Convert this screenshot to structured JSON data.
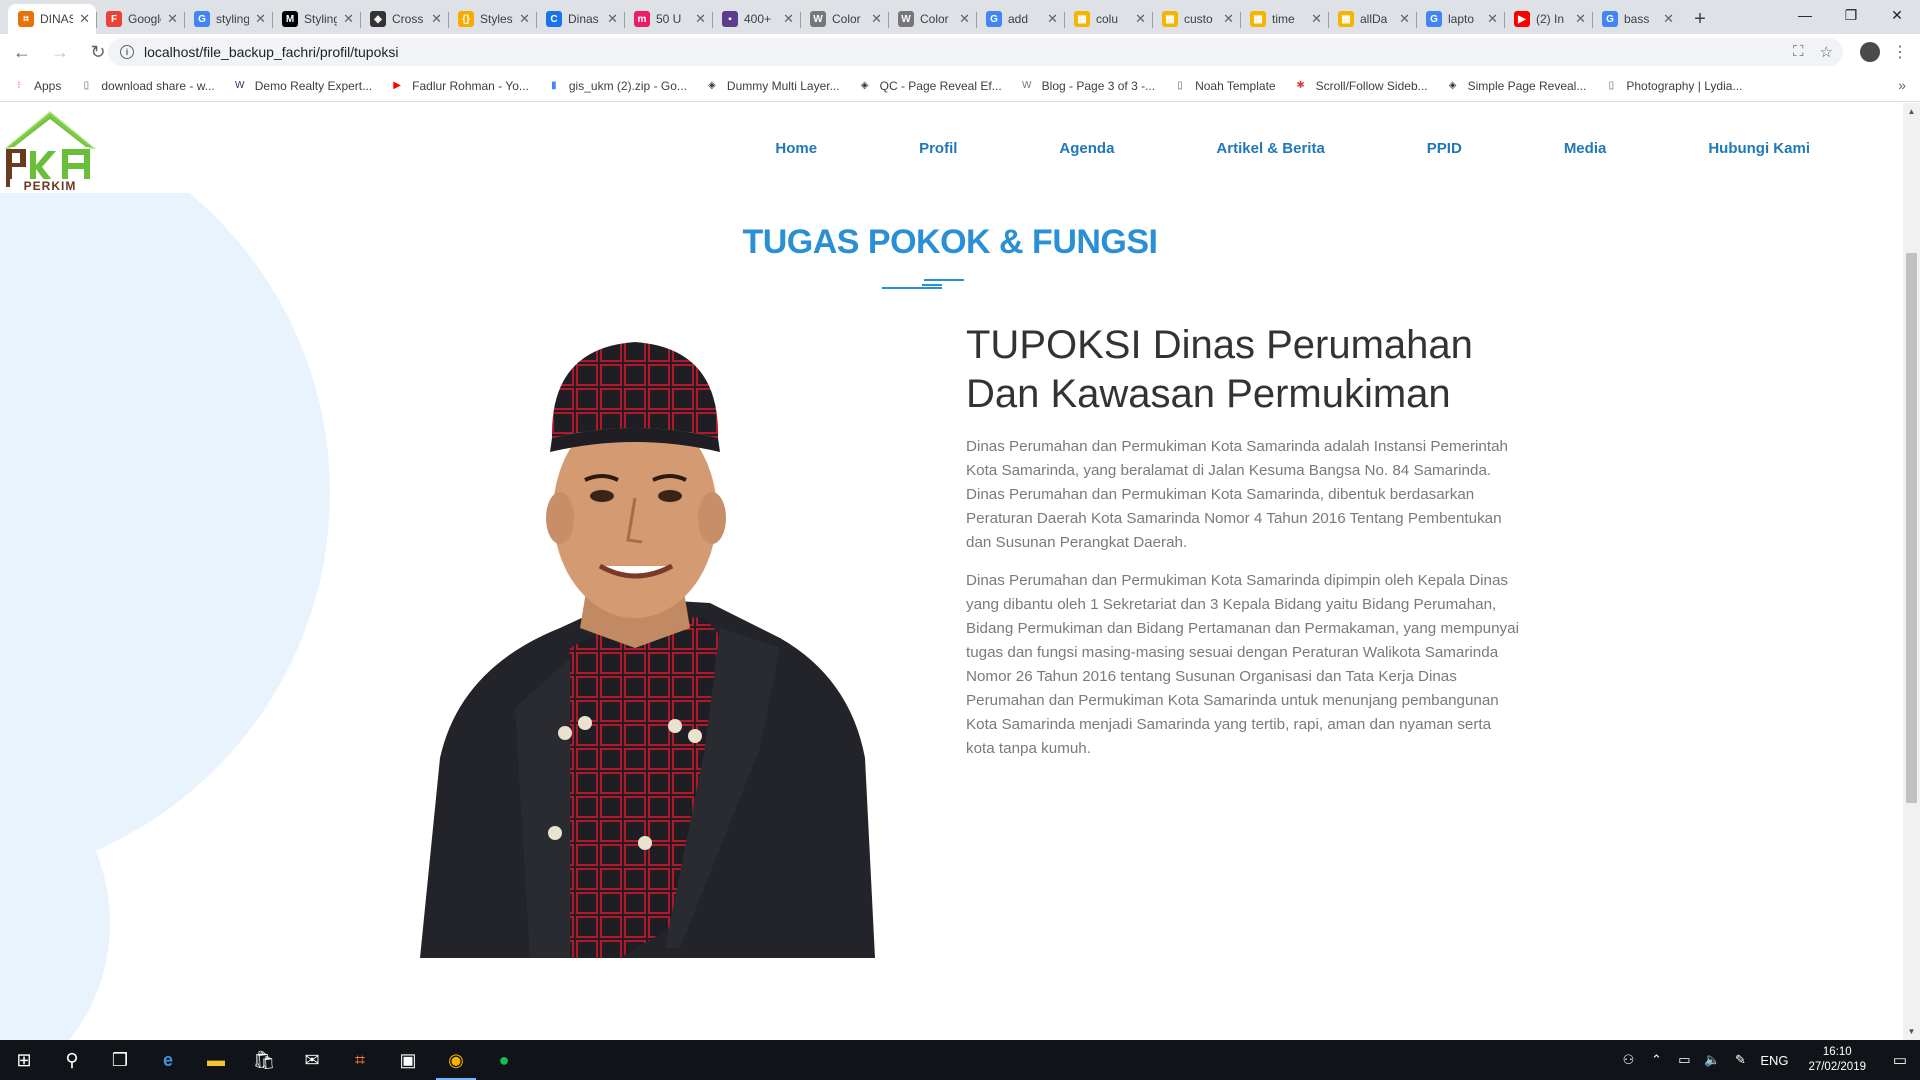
{
  "browser": {
    "tabs": [
      {
        "title": "DINAS",
        "color": "#e8710a",
        "glyph": "⌗",
        "active": true
      },
      {
        "title": "Google",
        "color": "#ea4335",
        "glyph": "F"
      },
      {
        "title": "styling",
        "color": "#4285f4",
        "glyph": "G"
      },
      {
        "title": "Styling",
        "color": "#000000",
        "glyph": "M"
      },
      {
        "title": "Cross",
        "color": "#333333",
        "glyph": "◈"
      },
      {
        "title": "Styles",
        "color": "#f9ab00",
        "glyph": "{}"
      },
      {
        "title": "Dinas",
        "color": "#1a73e8",
        "glyph": "C"
      },
      {
        "title": "50 U",
        "color": "#e91e63",
        "glyph": "m"
      },
      {
        "title": "400+",
        "color": "#5c3c8c",
        "glyph": "▪"
      },
      {
        "title": "Color",
        "color": "#777777",
        "glyph": "W"
      },
      {
        "title": "Color",
        "color": "#777777",
        "glyph": "W"
      },
      {
        "title": "add",
        "color": "#4285f4",
        "glyph": "G"
      },
      {
        "title": "colu",
        "color": "#f4b400",
        "glyph": "▦"
      },
      {
        "title": "custo",
        "color": "#f4b400",
        "glyph": "▦"
      },
      {
        "title": "time",
        "color": "#f4b400",
        "glyph": "▦"
      },
      {
        "title": "allDa",
        "color": "#f4b400",
        "glyph": "▦"
      },
      {
        "title": "lapto",
        "color": "#4285f4",
        "glyph": "G"
      },
      {
        "title": "(2) In",
        "color": "#ff0000",
        "glyph": "▶"
      },
      {
        "title": "bass",
        "color": "#4285f4",
        "glyph": "G"
      }
    ],
    "new_tab": "+",
    "window_controls": {
      "minimize": "—",
      "restore": "❐",
      "close": "✕"
    },
    "url": "localhost/file_backup_fachri/profil/tupoksi",
    "bookmarks": [
      {
        "label": "Apps",
        "color": "#ea4335",
        "glyph": "⁝"
      },
      {
        "label": "download share - w...",
        "color": "#5f6368",
        "glyph": "▯"
      },
      {
        "label": "Demo Realty Expert...",
        "color": "#1e3a5f",
        "glyph": "W"
      },
      {
        "label": "Fadlur Rohman - Yo...",
        "color": "#ff0000",
        "glyph": "▶"
      },
      {
        "label": "gis_ukm (2).zip - Go...",
        "color": "#4285f4",
        "glyph": "▮"
      },
      {
        "label": "Dummy Multi Layer...",
        "color": "#333333",
        "glyph": "◈"
      },
      {
        "label": "QC - Page Reveal Ef...",
        "color": "#333333",
        "glyph": "◈"
      },
      {
        "label": "Blog - Page 3 of 3 -...",
        "color": "#777777",
        "glyph": "W"
      },
      {
        "label": "Noah Template",
        "color": "#5f6368",
        "glyph": "▯"
      },
      {
        "label": "Scroll/Follow Sideb...",
        "color": "#e53935",
        "glyph": "✱"
      },
      {
        "label": "Simple Page Reveal...",
        "color": "#333333",
        "glyph": "◈"
      },
      {
        "label": "Photography | Lydia...",
        "color": "#5f6368",
        "glyph": "▯"
      }
    ],
    "bookmarks_more": "»"
  },
  "site": {
    "logo_text": "PERKIM",
    "nav": [
      "Home",
      "Profil",
      "Agenda",
      "Artikel & Berita",
      "PPID",
      "Media",
      "Hubungi Kami"
    ],
    "section_title": "TUGAS POKOK & FUNGSI",
    "heading": "TUPOKSI Dinas Perumahan Dan Kawasan Permukiman",
    "paragraph_1": "Dinas Perumahan dan Permukiman Kota Samarinda adalah Instansi Pemerintah Kota Samarinda, yang beralamat di Jalan Kesuma Bangsa No. 84 Samarinda. Dinas Perumahan dan Permukiman Kota Samarinda, dibentuk berdasarkan Peraturan Daerah Kota Samarinda Nomor 4 Tahun 2016 Tentang Pembentukan dan Susunan Perangkat Daerah.",
    "paragraph_2": "Dinas Perumahan dan Permukiman Kota Samarinda dipimpin oleh Kepala Dinas yang dibantu oleh 1 Sekretariat dan 3 Kepala Bidang yaitu Bidang Perumahan, Bidang Permukiman dan Bidang Pertamanan dan Permakaman, yang mempunyai tugas dan fungsi masing-masing sesuai dengan Peraturan Walikota Samarinda Nomor 26 Tahun 2016 tentang Susunan Organisasi dan Tata Kerja Dinas Perumahan dan Permukiman Kota Samarinda untuk menunjang pembangunan Kota Samarinda menjadi Samarinda yang tertib, rapi, aman dan nyaman serta kota tanpa kumuh."
  },
  "taskbar": {
    "language": "ENG",
    "time": "16:10",
    "date": "27/02/2019"
  },
  "colors": {
    "accent": "#2b8fd6",
    "nav": "#1f78b8",
    "blob": "#e9f3fd"
  }
}
